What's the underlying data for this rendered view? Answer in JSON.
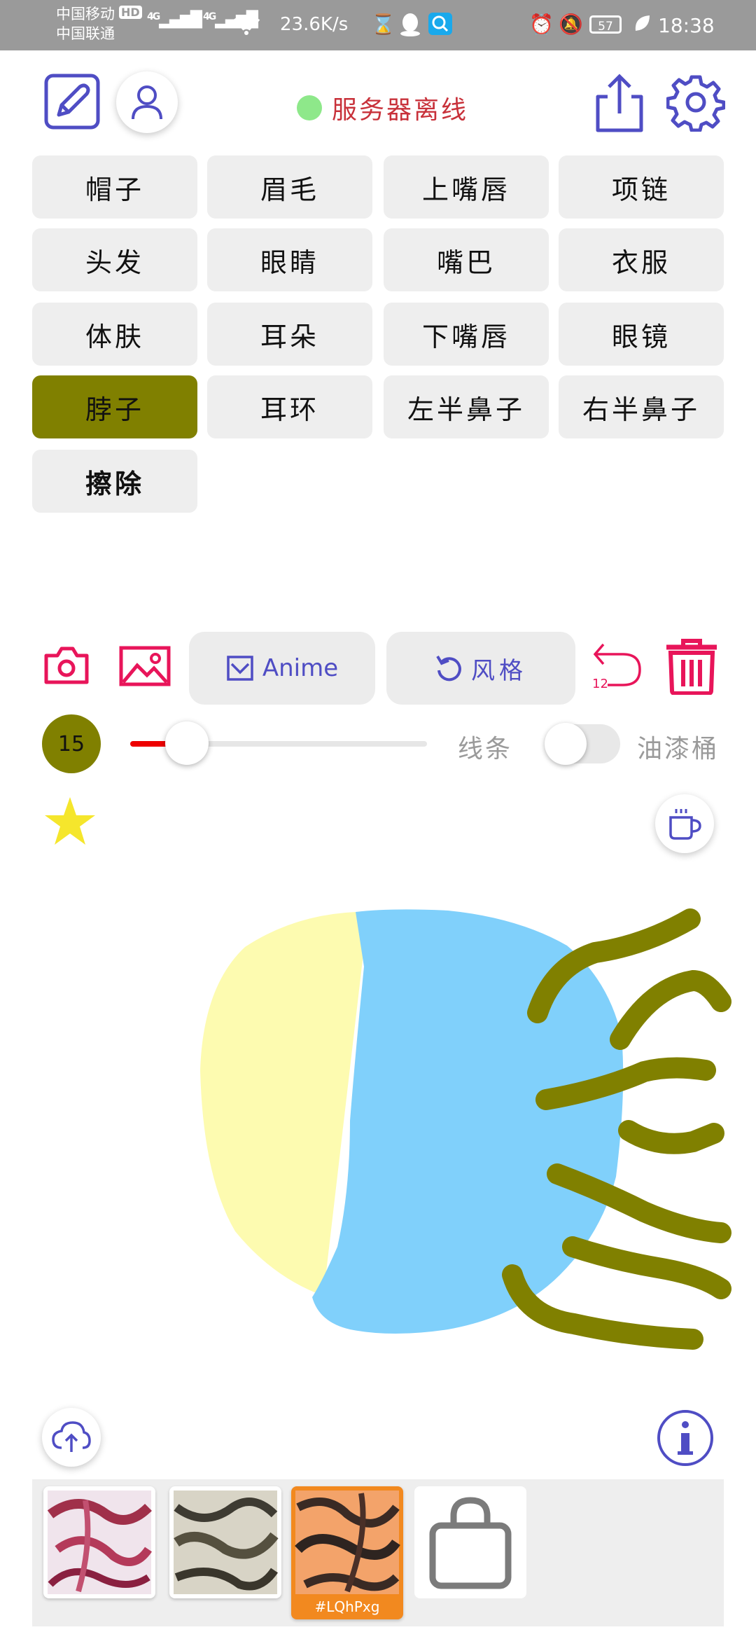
{
  "status_bar": {
    "carrier_1": "中国移动",
    "carrier_2": "中国联通",
    "hd_badge": "HD",
    "network_1": "4G",
    "network_2": "4G",
    "speed": "23.6K/s",
    "battery": "57",
    "time": "18:38"
  },
  "header": {
    "server_status": "服务器离线",
    "status_color": "#8ee88a"
  },
  "parts": [
    {
      "label": "帽子"
    },
    {
      "label": "眉毛"
    },
    {
      "label": "上嘴唇"
    },
    {
      "label": "项链"
    },
    {
      "label": "头发"
    },
    {
      "label": "眼睛"
    },
    {
      "label": "嘴巴"
    },
    {
      "label": "衣服"
    },
    {
      "label": "体肤"
    },
    {
      "label": "耳朵"
    },
    {
      "label": "下嘴唇"
    },
    {
      "label": "眼镜"
    },
    {
      "label": "脖子",
      "active": true
    },
    {
      "label": "耳环"
    },
    {
      "label": "左半鼻子"
    },
    {
      "label": "右半鼻子"
    },
    {
      "label": "擦除"
    }
  ],
  "toolbar": {
    "anime_label": "Anime",
    "style_label": "风格",
    "undo_count": "12"
  },
  "brush": {
    "size": "15",
    "slider_fraction": 0.19,
    "line_label": "线条",
    "bucket_label": "油漆桶",
    "bucket_enabled": false,
    "active_color": "#808000"
  },
  "gallery": {
    "selected_tag": "#LQhPxg"
  },
  "colors": {
    "accent": "#4f4dc4",
    "danger": "#e8155a",
    "olive": "#808000",
    "skin": "#fdfbb0",
    "face": "#80d0fb"
  }
}
